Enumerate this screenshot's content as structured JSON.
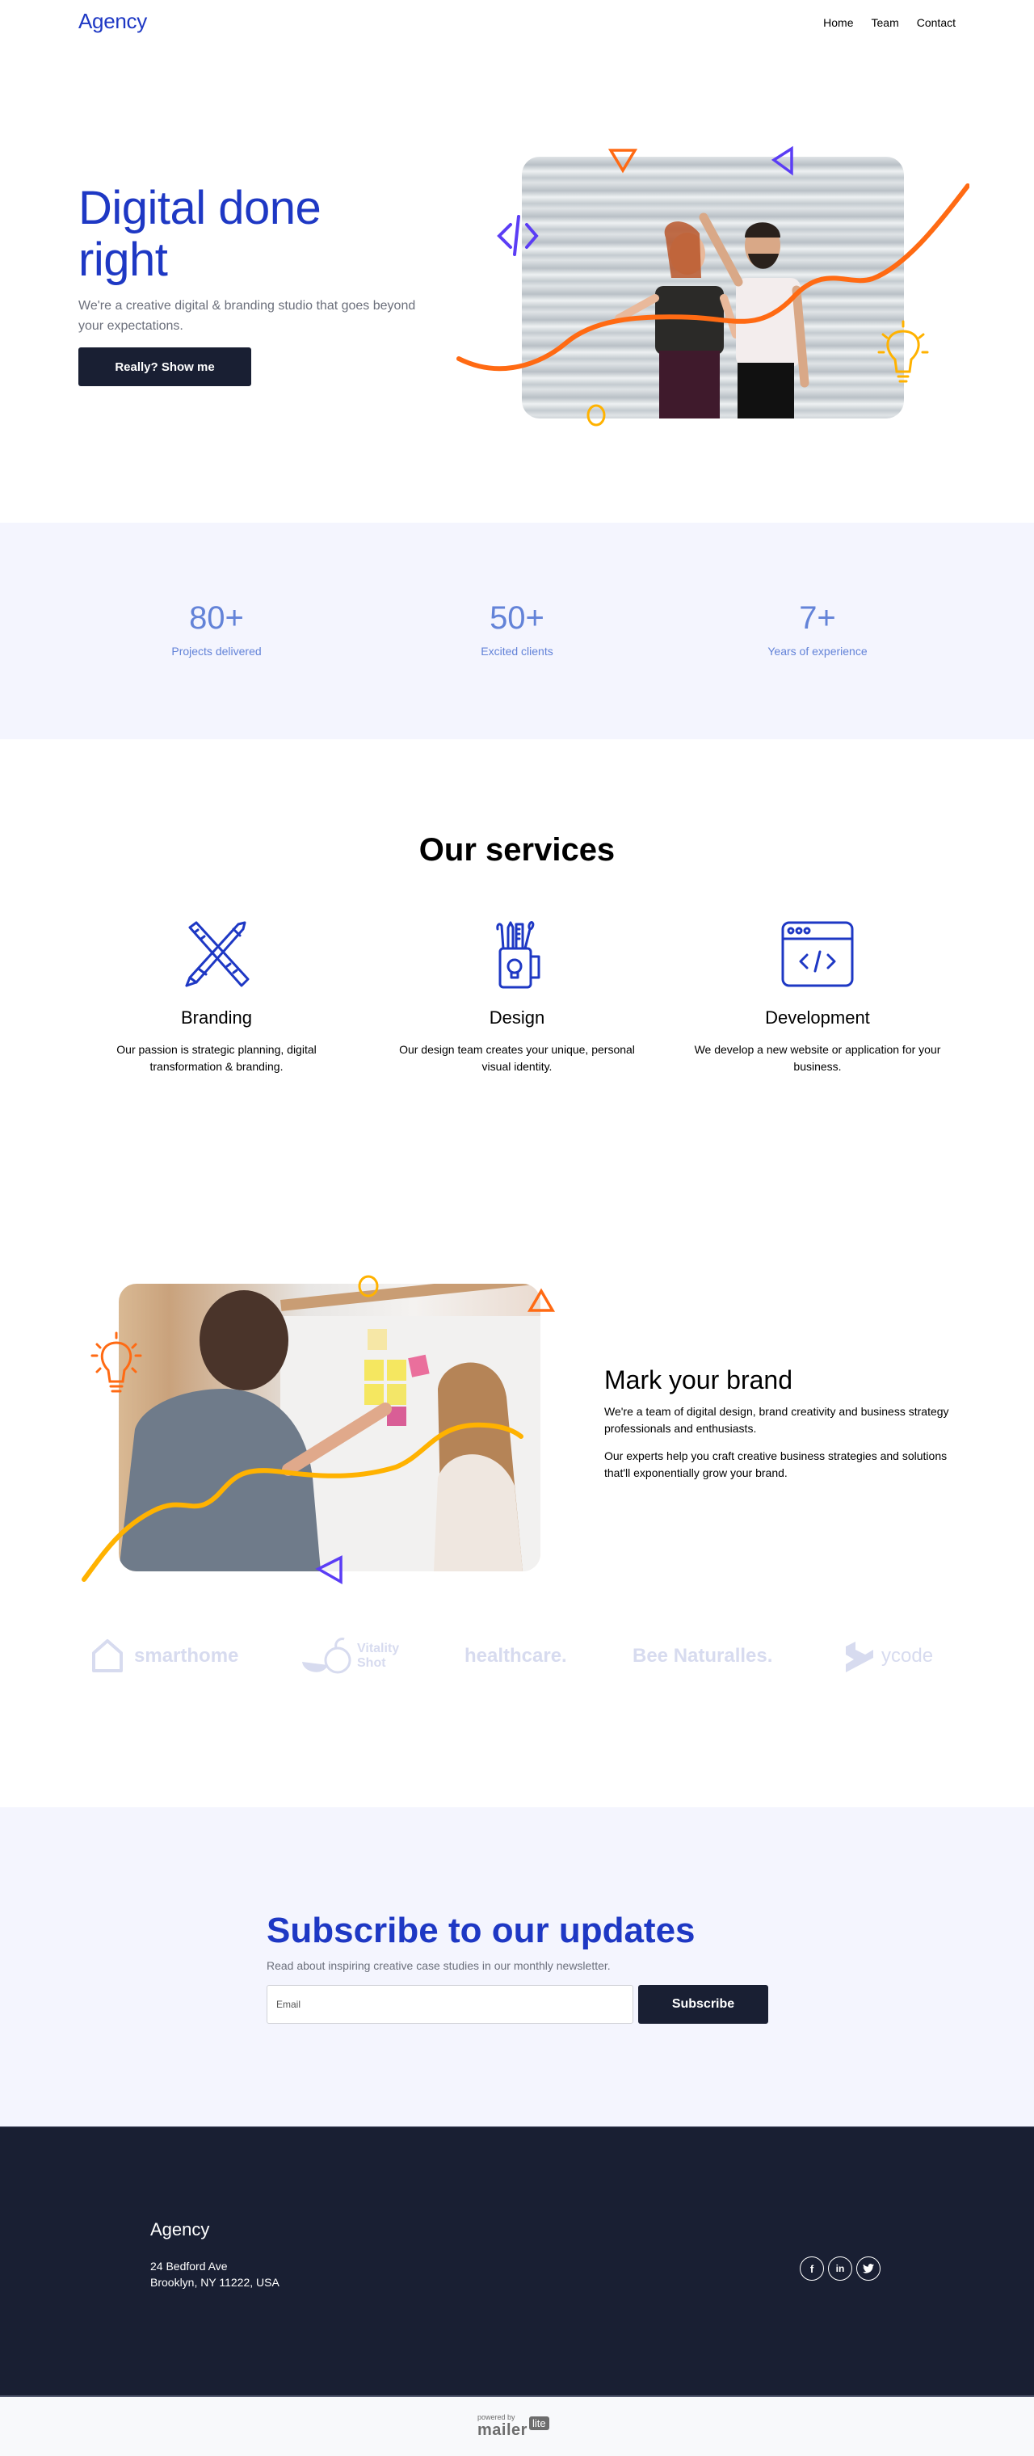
{
  "header": {
    "logo": "Agency",
    "nav": [
      "Home",
      "Team",
      "Contact"
    ]
  },
  "hero": {
    "title_line1": "Digital done",
    "title_line2": "right",
    "subtitle": "We're a creative digital & branding studio that goes beyond your expectations.",
    "cta_label": "Really? Show me",
    "image_alt": "Laughing couple in front of a corrugated metal wall"
  },
  "stats": [
    {
      "value": "80+",
      "label": "Projects delivered"
    },
    {
      "value": "50+",
      "label": "Excited clients"
    },
    {
      "value": "7+",
      "label": "Years of experience"
    }
  ],
  "services": {
    "title": "Our services",
    "items": [
      {
        "icon": "ruler-pencil-icon",
        "title": "Branding",
        "text": "Our passion is strategic planning, digital transformation & branding."
      },
      {
        "icon": "pencil-cup-icon",
        "title": "Design",
        "text": "Our design team creates your unique, personal visual identity."
      },
      {
        "icon": "browser-code-icon",
        "title": "Development",
        "text": "We develop a new website or application for your business."
      }
    ]
  },
  "brand": {
    "title": "Mark your brand",
    "p1": "We're a team of digital design, brand creativity and business strategy professionals and enthusiasts.",
    "p2": "Our experts help you craft creative business strategies and solutions that'll exponentially grow your brand.",
    "image_alt": "Team members working at a whiteboard with sticky notes"
  },
  "client_logos": [
    {
      "name": "smarthome"
    },
    {
      "name_line1": "Vitality",
      "name_line2": "Shot"
    },
    {
      "name": "healthcare."
    },
    {
      "name": "Bee Naturalles."
    },
    {
      "name": "ycode"
    }
  ],
  "subscribe": {
    "title": "Subscribe to our updates",
    "text": "Read about inspiring creative case studies in our monthly newsletter.",
    "email_placeholder": "Email",
    "email_value": "",
    "button_label": "Subscribe"
  },
  "footer": {
    "logo": "Agency",
    "address_line1": "24 Bedford Ave",
    "address_line2": "Brooklyn, NY 11222, USA",
    "socials": [
      {
        "icon": "facebook-icon",
        "glyph": "f"
      },
      {
        "icon": "linkedin-icon",
        "glyph": "in"
      },
      {
        "icon": "twitter-icon",
        "glyph": "t"
      }
    ]
  },
  "powered_by": {
    "prefix": "powered by",
    "brand": "mailer",
    "badge": "lite"
  },
  "colors": {
    "brand_blue": "#1e38c4",
    "stat_blue": "#6383d8",
    "dark_navy": "#191f33",
    "band_bg": "#f4f5fe",
    "accent_orange": "#ff6a13",
    "accent_yellow": "#ffb200",
    "accent_purple": "#5b3df5"
  }
}
